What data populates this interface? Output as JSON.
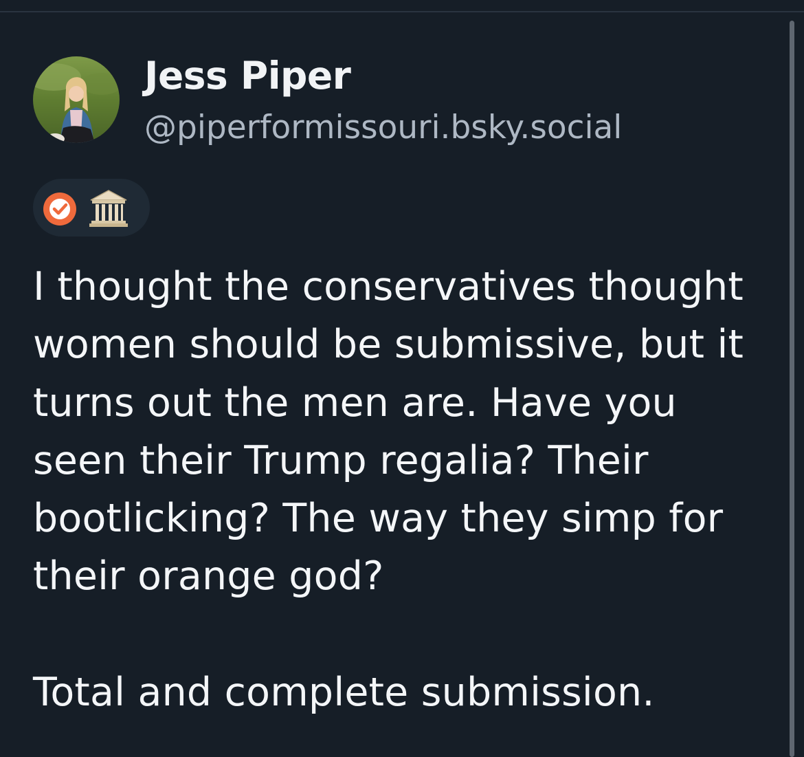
{
  "post": {
    "author": {
      "display_name": "Jess Piper",
      "handle": "@piperformissouri.bsky.social"
    },
    "badges": [
      {
        "icon": "verified-check-icon",
        "color": "#ef6a3c"
      },
      {
        "icon": "classical-building-icon"
      }
    ],
    "text_lines": [
      "I thought the conservatives thought",
      "women should be submissive, but it",
      "turns out the men are. Have you",
      "seen their Trump regalia? Their",
      "bootlicking? The way they simp for",
      "their orange god?",
      "",
      "Total and complete submission."
    ]
  },
  "colors": {
    "background": "#161e27",
    "text": "#f4f6f8",
    "handle": "#aeb8c4",
    "badge_background": "#1f2a35"
  }
}
